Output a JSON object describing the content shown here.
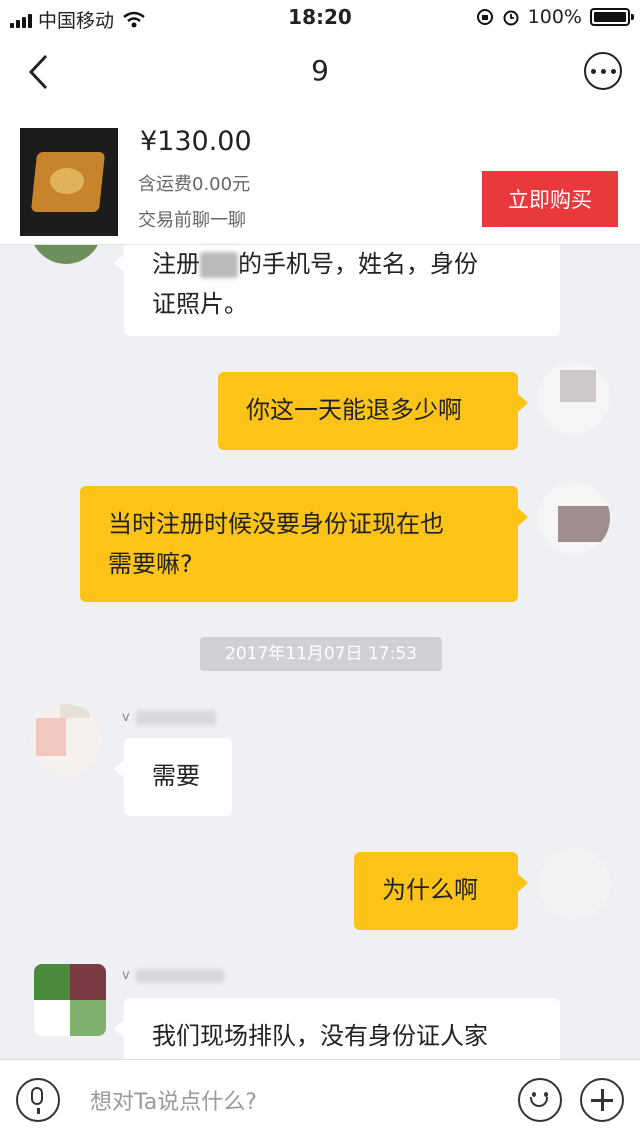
{
  "status_bar": {
    "carrier": "中国移动",
    "time": "18:20",
    "battery": "100%"
  },
  "nav": {
    "title": "9"
  },
  "product": {
    "price": "¥130.00",
    "shipping": "含运费0.00元",
    "prechat": "交易前聊一聊",
    "buy_label": "立即购买"
  },
  "messages": [
    {
      "side": "left",
      "line1_pre": "注册",
      "line1_post": "的手机号，姓名，身份",
      "line2": "证照片。"
    },
    {
      "side": "right",
      "text": "你这一天能退多少啊"
    },
    {
      "side": "right",
      "line1": "当时注册时候没要身份证现在也",
      "line2": "需要嘛?"
    },
    {
      "side": "left",
      "text": "需要"
    },
    {
      "side": "right",
      "text": "为什么啊"
    },
    {
      "side": "left",
      "text": "我们现场排队，没有身份证人家"
    }
  ],
  "timestamp": "2017年11月07日 17:53",
  "senders": {
    "first": "v",
    "second": "v"
  },
  "input": {
    "placeholder": "想对Ta说点什么?"
  },
  "icons": {
    "back": "chevron-left-icon",
    "more": "more-dots-icon",
    "mic": "microphone-icon",
    "emoji": "smile-icon",
    "plus": "plus-icon"
  },
  "colors": {
    "accent": "#e9393c",
    "bubble_self": "#fcc419",
    "background": "#eef0f3"
  }
}
